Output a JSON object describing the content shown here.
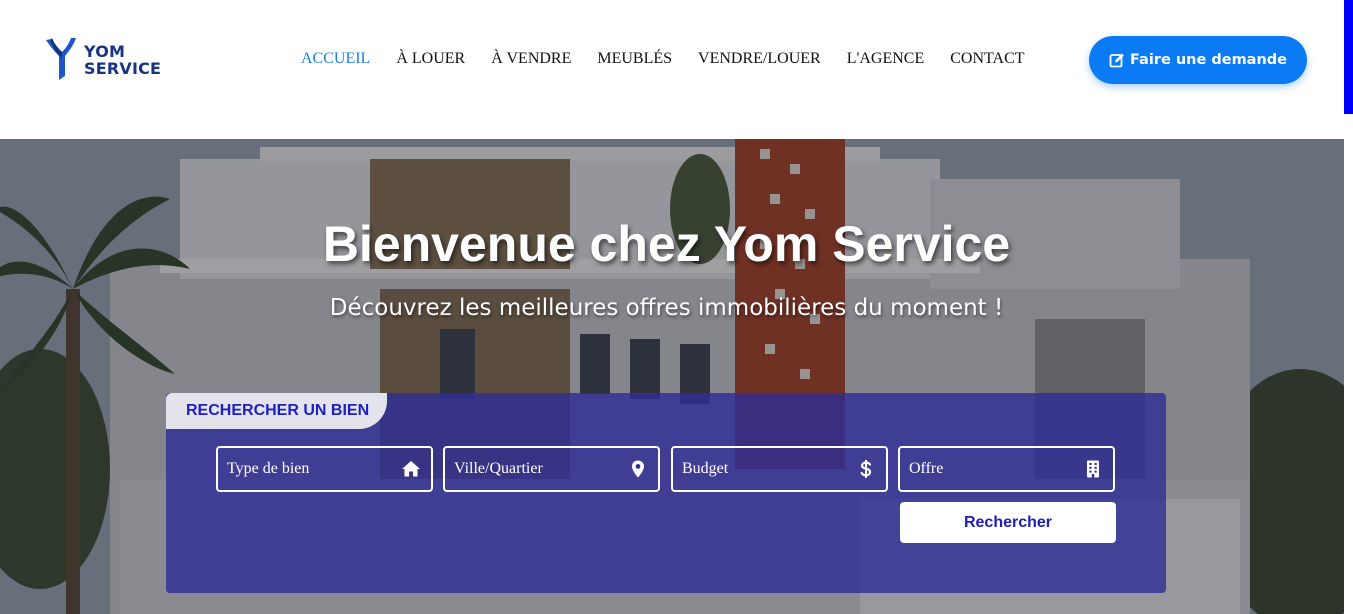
{
  "brand": {
    "line1": "YOM",
    "line2": "SERVICE",
    "logo_icon": "yom-y-monogram-icon",
    "color": "#17347f"
  },
  "nav": {
    "items": [
      {
        "label": "ACCUEIL",
        "active": true
      },
      {
        "label": "À LOUER",
        "active": false
      },
      {
        "label": "À VENDRE",
        "active": false
      },
      {
        "label": "MEUBLÉS",
        "active": false
      },
      {
        "label": "VENDRE/LOUER",
        "active": false
      },
      {
        "label": "L'AGENCE",
        "active": false
      },
      {
        "label": "CONTACT",
        "active": false
      }
    ],
    "active_color": "#1f7ee0"
  },
  "cta": {
    "label": "Faire une demande",
    "icon": "edit-icon",
    "color": "#0a7bf4"
  },
  "hero": {
    "title": "Bienvenue chez Yom Service",
    "subtitle": "Découvrez les meilleures offres immobilières du moment !"
  },
  "search": {
    "tab_label": "RECHERCHER UN BIEN",
    "fields": [
      {
        "label": "Type de bien",
        "icon": "home-icon"
      },
      {
        "label": "Ville/Quartier",
        "icon": "map-pin-icon"
      },
      {
        "label": "Budget",
        "icon": "dollar-icon"
      },
      {
        "label": "Offre",
        "icon": "building-icon"
      }
    ],
    "button_label": "Rechercher",
    "panel_color": "#302e96"
  }
}
